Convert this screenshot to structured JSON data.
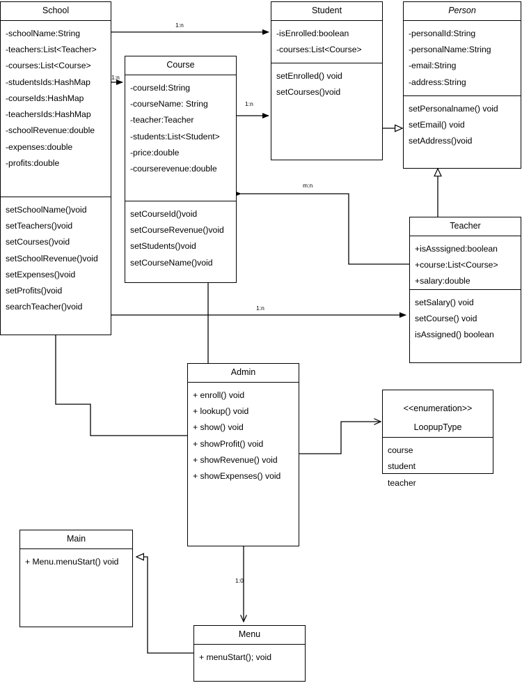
{
  "diagram": {
    "kind": "uml-class-diagram",
    "stroke_color": "#000000",
    "background_color": "#ffffff"
  },
  "classes": {
    "school": {
      "name": "School",
      "attributes": [
        "-schoolName:String",
        "-teachers:List<Teacher>",
        "-courses:List<Course>",
        "-studentsIds:HashMap",
        "-courseIds:HashMap",
        "-teachersIds:HashMap",
        "-schoolRevenue:double",
        "-expenses:double",
        "-profits:double"
      ],
      "methods": [
        "setSchoolName()void",
        "setTeachers()void",
        "setCourses()void",
        "setSchoolRevenue()void",
        "setExpenses()void",
        "setProfits()void",
        "searchTeacher()void"
      ]
    },
    "course": {
      "name": "Course",
      "attributes": [
        "-courseId:String",
        "-courseName: String",
        "-teacher:Teacher",
        "-students:List<Student>",
        "-price:double",
        "-courserevenue:double"
      ],
      "methods": [
        "setCourseId()void",
        "setCourseRevenue()void",
        "setStudents()void",
        "setCourseName()void"
      ]
    },
    "student": {
      "name": "Student",
      "attributes": [
        "-isEnrolled:boolean",
        "-courses:List<Course>"
      ],
      "methods": [
        "setEnrolled() void",
        "setCourses()void"
      ]
    },
    "person": {
      "name": "Person",
      "abstract": true,
      "attributes": [
        "-personalId:String",
        "-personalName:String",
        "-email:String",
        "-address:String"
      ],
      "methods": [
        "setPersonalname() void",
        "setEmail() void",
        "setAddress()void"
      ]
    },
    "teacher": {
      "name": "Teacher",
      "attributes": [
        "+isAsssigned:boolean",
        "+course:List<Course>",
        "+salary:double"
      ],
      "methods": [
        "setSalary() void",
        "setCourse() void",
        "isAssigned() boolean"
      ]
    },
    "admin": {
      "name": "Admin",
      "attributes": [],
      "methods": [
        "+ enroll() void",
        "+ lookup() void",
        "+ show() void",
        "+ showProfit() void",
        "+ showRevenue() void",
        "+ showExpenses() void"
      ]
    },
    "lookup_enum": {
      "stereotype": "<<enumeration>>",
      "name": "LoopupType",
      "values": [
        "course",
        "student",
        "teacher"
      ]
    },
    "main": {
      "name": "Main",
      "methods": [
        "+ Menu.menuStart() void"
      ]
    },
    "menu": {
      "name": "Menu",
      "methods": [
        "+ menuStart(); void"
      ]
    }
  },
  "relationships": [
    {
      "id": "school-student",
      "label": "1:n",
      "from": "School",
      "to": "Student",
      "arrow": "filled"
    },
    {
      "id": "school-course",
      "label": "1:n",
      "from": "School",
      "to": "Course",
      "arrow": "filled"
    },
    {
      "id": "course-student",
      "label": "1:n",
      "from": "Course",
      "to": "Student",
      "arrow": "filled"
    },
    {
      "id": "teacher-course",
      "label": "m:n",
      "from": "Teacher",
      "to": "Course",
      "arrow": "filled"
    },
    {
      "id": "school-teacher",
      "label": "1:n",
      "from": "School",
      "to": "Teacher",
      "arrow": "filled"
    },
    {
      "id": "student-person",
      "label": "",
      "from": "Student",
      "to": "Person",
      "arrow": "hollow-triangle"
    },
    {
      "id": "teacher-person",
      "label": "",
      "from": "Teacher",
      "to": "Person",
      "arrow": "hollow-triangle"
    },
    {
      "id": "admin-lookup",
      "label": "",
      "from": "Admin",
      "to": "LoopupType",
      "arrow": "open"
    },
    {
      "id": "admin-menu",
      "label": "1:0",
      "from": "Admin",
      "to": "Menu",
      "arrow": "open"
    },
    {
      "id": "menu-main",
      "label": "",
      "from": "Menu",
      "to": "Main",
      "arrow": "hollow-triangle"
    },
    {
      "id": "school-admin",
      "label": "",
      "from": "School",
      "to": "Admin",
      "arrow": "none"
    },
    {
      "id": "course-admin",
      "label": "",
      "from": "Course",
      "to": "Admin",
      "arrow": "none"
    }
  ],
  "edge_labels": {
    "school_student": "1:n",
    "school_course": "1:n",
    "course_student": "1:n",
    "teacher_course": "m:n",
    "school_teacher": "1:n",
    "admin_menu": "1:0"
  }
}
